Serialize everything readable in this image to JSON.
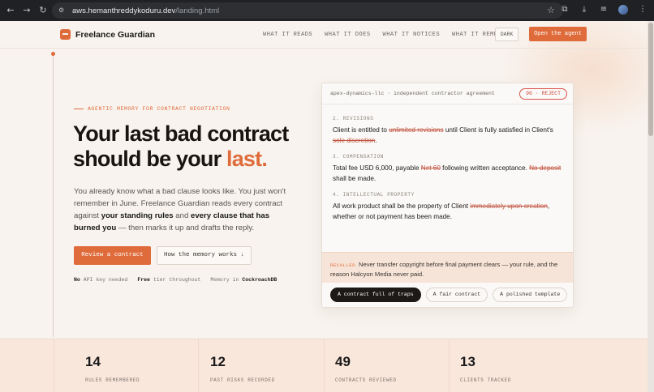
{
  "browser": {
    "url_host": "aws.hemanthreddykoduru.dev",
    "url_path": "/landing.html"
  },
  "nav": {
    "brand": "Freelance Guardian",
    "links": [
      "WHAT IT READS",
      "WHAT IT DOES",
      "WHAT IT NOTICES",
      "WHAT IT REMEMBERS"
    ],
    "dark_label": "DARK",
    "cta_label": "Open the agent"
  },
  "hero": {
    "eyebrow": "AGENTIC MEMORY FOR CONTRACT NEGOTIATION",
    "headline_main": "Your last bad contract should be your ",
    "headline_accent": "last.",
    "lede_1": "You already know what a bad clause looks like. You just won't remember in June. Freelance Guardian reads every contract against ",
    "lede_b1": "your standing rules",
    "lede_2": " and ",
    "lede_b2": "every clause that has burned you",
    "lede_3": " — then marks it up and drafts the reply.",
    "primary_button": "Review a contract",
    "secondary_button": "How the memory works ↓",
    "meta": [
      {
        "bold": "No",
        "text": " API key needed"
      },
      {
        "bold": "Free",
        "text": " tier throughout"
      },
      {
        "text": "Memory in ",
        "bold_end": "CockroachDB"
      }
    ]
  },
  "card": {
    "title": "apex-dynamics-llc · independent contractor agreement",
    "badge": "96 · REJECT",
    "clauses": [
      {
        "label": "2. REVISIONS",
        "parts": [
          {
            "t": "Client is entitled to "
          },
          {
            "t": "unlimited revisions",
            "s": true
          },
          {
            "t": " until Client is fully satisfied in Client's "
          },
          {
            "t": "sole discretion",
            "s": true
          },
          {
            "t": "."
          }
        ]
      },
      {
        "label": "3. COMPENSATION",
        "parts": [
          {
            "t": "Total fee USD 6,000, payable "
          },
          {
            "t": "Net 60",
            "s": true
          },
          {
            "t": " following written acceptance. "
          },
          {
            "t": "No deposit",
            "s": true
          },
          {
            "t": " shall be made."
          }
        ]
      },
      {
        "label": "4. INTELLECTUAL PROPERTY",
        "parts": [
          {
            "t": "All work product shall be the property of Client "
          },
          {
            "t": "immediately upon creation",
            "s": true
          },
          {
            "t": ", whether or not payment has been made."
          }
        ]
      }
    ],
    "recall_tag": "RECALLED",
    "recall_text": "Never transfer copyright before final payment clears — your rule, and the reason Halcyon Media never paid.",
    "tabs": [
      "A contract full of traps",
      "A fair contract",
      "A polished template"
    ],
    "active_tab": 0
  },
  "stats": [
    {
      "value": "14",
      "label": "RULES REMEMBERED"
    },
    {
      "value": "12",
      "label": "PAST RISKS RECORDED"
    },
    {
      "value": "49",
      "label": "CONTRACTS REVIEWED"
    },
    {
      "value": "13",
      "label": "CLIENTS TRACKED"
    }
  ],
  "colors": {
    "accent": "#df6b3a",
    "page_bg": "#f8f3ee",
    "stats_bg": "#fae7dc",
    "reject": "#c84a3f"
  }
}
